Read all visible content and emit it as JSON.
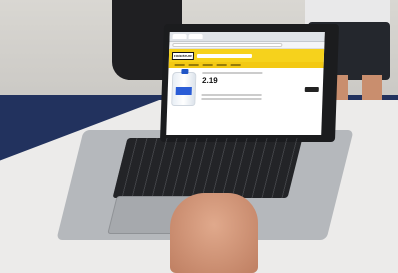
{
  "scene": {
    "description_free": true
  },
  "screen": {
    "site": {
      "logo_text": "FOODSTUFF",
      "header_color": "#f6d21c",
      "price": "2.19"
    }
  },
  "colors": {
    "wall": "#d3d1cc",
    "floor": "#22325e",
    "table": "#ecebea",
    "laptop": "#b5b8bc",
    "accent_yellow": "#f6d21c"
  }
}
